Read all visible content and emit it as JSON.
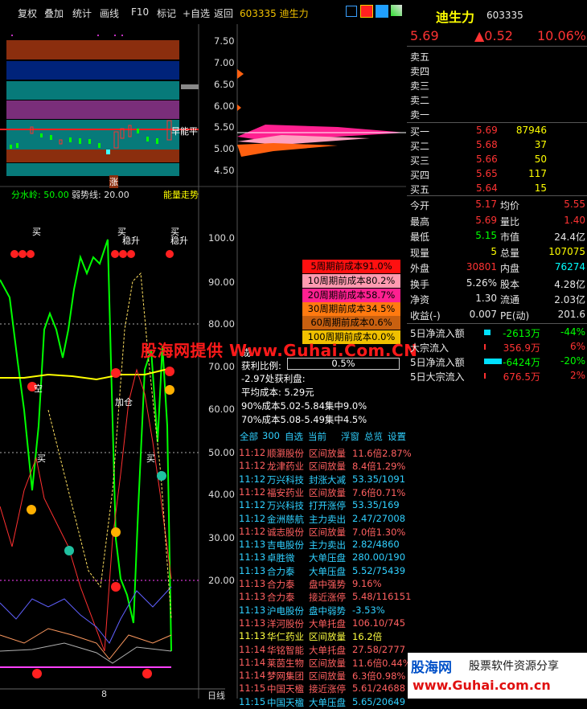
{
  "toolbar": {
    "items": [
      "复权",
      "叠加",
      "统计",
      "画线",
      "F10",
      "标记",
      "+自选",
      "返回"
    ],
    "stock_code_name": "603335 迪生力",
    "period_tab": "日线",
    "date_tick": "8"
  },
  "quote": {
    "name": "迪生力",
    "code": "603335",
    "price": "5.69",
    "change": "▲0.52",
    "pct": "10.06%",
    "colors": {
      "up": "#ff3333",
      "down": "#00e000",
      "yellow": "#ffff00",
      "text": "#e8e8e8"
    }
  },
  "order_book": {
    "asks": [
      "卖五",
      "卖四",
      "卖三",
      "卖二",
      "卖一"
    ],
    "bids": [
      {
        "label": "买一",
        "price": "5.69",
        "vol": "87946"
      },
      {
        "label": "买二",
        "price": "5.68",
        "vol": "37"
      },
      {
        "label": "买三",
        "price": "5.66",
        "vol": "50"
      },
      {
        "label": "买四",
        "price": "5.65",
        "vol": "117"
      },
      {
        "label": "买五",
        "price": "5.64",
        "vol": "15"
      }
    ]
  },
  "stats": [
    {
      "l1": "今开",
      "v1": "5.17",
      "l2": "均价",
      "v2": "5.55"
    },
    {
      "l1": "最高",
      "v1": "5.69",
      "l2": "量比",
      "v2": "1.40"
    },
    {
      "l1": "最低",
      "v1": "5.15",
      "l2": "市值",
      "v2": "24.4亿"
    },
    {
      "l1": "现量",
      "v1": "5",
      "l2": "总量",
      "v2": "107075"
    },
    {
      "l1": "外盘",
      "v1": "30801",
      "l2": "内盘",
      "v2": "76274"
    },
    {
      "l1": "换手",
      "v1": "5.26%",
      "l2": "股本",
      "v2": "4.28亿"
    },
    {
      "l1": "净资",
      "v1": "1.30",
      "l2": "流通",
      "v2": "2.03亿"
    },
    {
      "l1": "收益(-)",
      "v1": "0.007",
      "l2": "PE(动)",
      "v2": "201.6"
    }
  ],
  "flows": [
    {
      "label": "5日净流入额",
      "value": "-2613万",
      "pct": "-44%"
    },
    {
      "label": "大宗流入",
      "value": "356.9万",
      "pct": "6%"
    },
    {
      "label": "5日净流入额",
      "value": "-6424万",
      "pct": "-20%"
    },
    {
      "label": "5日大宗流入",
      "value": "676.5万",
      "pct": "2%"
    }
  ],
  "price_axis": [
    "7.50",
    "7.00",
    "6.50",
    "6.00",
    "5.50",
    "5.00",
    "4.50"
  ],
  "indicator_axis": [
    "100.0",
    "90.00",
    "80.00",
    "70.00",
    "60.00",
    "50.00",
    "40.00",
    "30.00",
    "20.00"
  ],
  "indicator_header": {
    "a": "分水岭: 50.00",
    "b": "弱势线: 20.00",
    "c": "能量走势"
  },
  "cost_periods": [
    {
      "label": "5周期前成本91.0%",
      "color": "#ff1010"
    },
    {
      "label": "10周期前成本80.2%",
      "color": "#ff9ab0"
    },
    {
      "label": "20周期前成本58.7%",
      "color": "#ff2090"
    },
    {
      "label": "30周期前成本34.5%",
      "color": "#ff7a10"
    },
    {
      "label": "60周期前成本0.6%",
      "color": "#c86010"
    },
    {
      "label": "100周期前成本0.0%",
      "color": "#f0c000"
    }
  ],
  "cost_info": {
    "cost_prefix": "成",
    "profit_label": "获利比例:",
    "profit_value": "0.5%",
    "profit_disk": "-2.97处获利盘:",
    "avg_cost": "平均成本: 5.29元",
    "c90": "90%成本5.02-5.84集中9.0%",
    "c70": "70%成本5.08-5.49集中4.5%"
  },
  "chart_labels": {
    "main_a": "早能平",
    "zhang": "涨",
    "buy": "买",
    "stable": "稳升",
    "jiacang": "加仓",
    "kong": "空"
  },
  "ticker_tabs": [
    "全部",
    "300",
    "自选",
    "当前",
    "浮窗",
    "总览",
    "设置"
  ],
  "ticker": [
    {
      "t": "11:12",
      "n": "顺灏股份",
      "a": "区间放量",
      "v": "11.6倍2.87%",
      "c": "#ff6060"
    },
    {
      "t": "11:12",
      "n": "龙津药业",
      "a": "区间放量",
      "v": "8.4倍1.29%",
      "c": "#ff6060"
    },
    {
      "t": "11:12",
      "n": "万兴科技",
      "a": "封涨大减",
      "v": "53.35/1091",
      "c": "#30d0ff"
    },
    {
      "t": "11:12",
      "n": "福安药业",
      "a": "区间放量",
      "v": "7.6倍0.71%",
      "c": "#ff6060"
    },
    {
      "t": "11:12",
      "n": "万兴科技",
      "a": "打开涨停",
      "v": "53.35/169",
      "c": "#30d0ff"
    },
    {
      "t": "11:12",
      "n": "金洲慈航",
      "a": "主力卖出",
      "v": "2.47/27008",
      "c": "#30d0ff"
    },
    {
      "t": "11:12",
      "n": "诚志股份",
      "a": "区间放量",
      "v": "7.0倍1.30%",
      "c": "#ff6060"
    },
    {
      "t": "11:13",
      "n": "吉电股份",
      "a": "主力卖出",
      "v": "2.82/4860",
      "c": "#30d0ff"
    },
    {
      "t": "11:13",
      "n": "卓胜微",
      "a": "大单压盘",
      "v": "280.00/190",
      "c": "#30d0ff"
    },
    {
      "t": "11:13",
      "n": "合力泰",
      "a": "大单压盘",
      "v": "5.52/75439",
      "c": "#30d0ff"
    },
    {
      "t": "11:13",
      "n": "合力泰",
      "a": "盘中强势",
      "v": "9.16%",
      "c": "#ff6060"
    },
    {
      "t": "11:13",
      "n": "合力泰",
      "a": "接近涨停",
      "v": "5.48/116151",
      "c": "#ff6060"
    },
    {
      "t": "11:13",
      "n": "沪电股份",
      "a": "盘中弱势",
      "v": "-3.53%",
      "c": "#30d0ff"
    },
    {
      "t": "11:13",
      "n": "洋河股份",
      "a": "大单托盘",
      "v": "106.10/745",
      "c": "#ff6060"
    },
    {
      "t": "11:13",
      "n": "华仁药业",
      "a": "区间放量",
      "v": "16.2倍",
      "c": "#ffff40"
    },
    {
      "t": "11:14",
      "n": "华铭智能",
      "a": "大单托盘",
      "v": "27.58/2777",
      "c": "#ff6060"
    },
    {
      "t": "11:14",
      "n": "莱茵生物",
      "a": "区间放量",
      "v": "11.6倍0.44%",
      "c": "#ff6060"
    },
    {
      "t": "11:14",
      "n": "梦网集团",
      "a": "区间放量",
      "v": "6.3倍0.98%",
      "c": "#ff6060"
    },
    {
      "t": "11:15",
      "n": "中国天楹",
      "a": "接近涨停",
      "v": "5.61/24688",
      "c": "#ff6060"
    },
    {
      "t": "11:15",
      "n": "中国天楹",
      "a": "大单压盘",
      "v": "5.65/20649",
      "c": "#30d0ff"
    }
  ],
  "watermark": "股海网提供 Www.Guhai.Com.CN",
  "logo": {
    "title": "股海网",
    "subtitle": "股票软件资源分享",
    "url": "www.Guhai.com.cn"
  }
}
